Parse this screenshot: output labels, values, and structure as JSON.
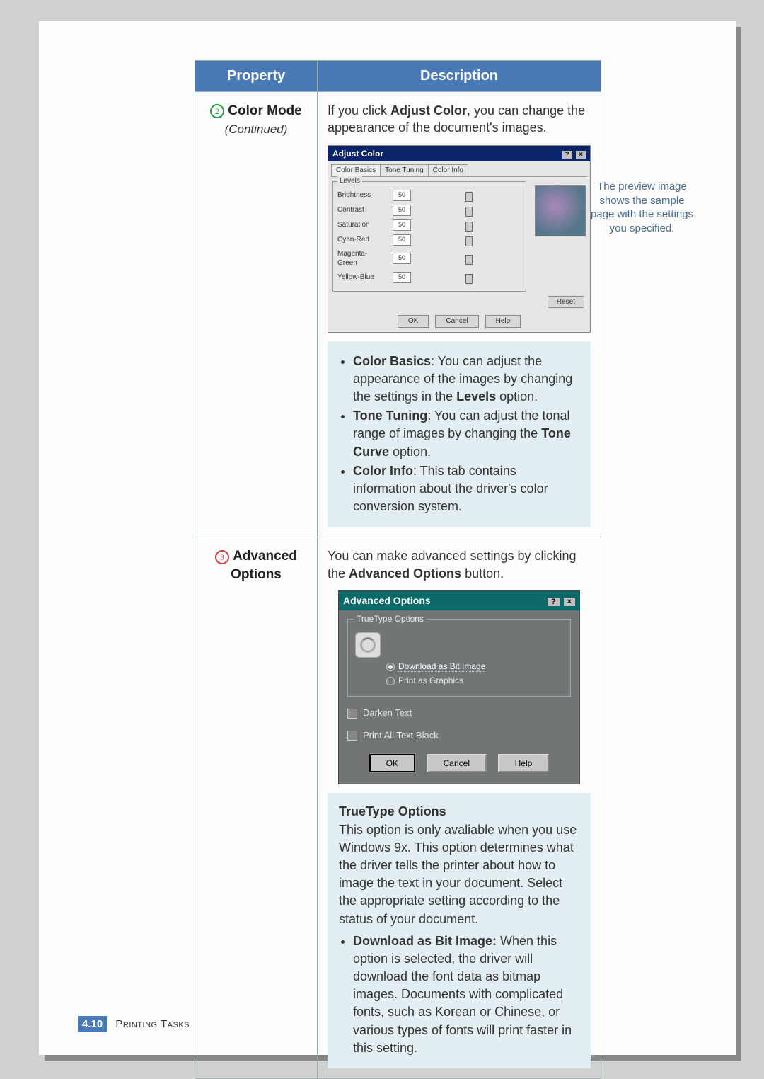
{
  "table": {
    "header_property": "Property",
    "header_description": "Description"
  },
  "row1": {
    "badge_num": "2",
    "title": "Color Mode",
    "subtitle": "(Continued)",
    "intro_a": "If you click ",
    "intro_b": "Adjust Color",
    "intro_c": ", you can change the appearance of the document's images.",
    "dialog": {
      "title": "Adjust Color",
      "tab1": "Color Basics",
      "tab2": "Tone Tuning",
      "tab3": "Color Info",
      "levels_label": "Levels",
      "sliders": [
        {
          "label": "Brightness",
          "value": "50"
        },
        {
          "label": "Contrast",
          "value": "50"
        },
        {
          "label": "Saturation",
          "value": "50"
        },
        {
          "label": "Cyan-Red",
          "value": "50"
        },
        {
          "label": "Magenta-Green",
          "value": "50"
        },
        {
          "label": "Yellow-Blue",
          "value": "50"
        }
      ],
      "reset": "Reset",
      "ok": "OK",
      "cancel": "Cancel",
      "help": "Help"
    },
    "preview_note": "The preview image shows the sample page with the settings you specified.",
    "bullets": {
      "b1a": "Color Basics",
      "b1b": ": You can adjust the appearance of the images by changing the settings in the ",
      "b1c": "Levels",
      "b1d": " option.",
      "b2a": "Tone Tuning",
      "b2b": ": You can adjust the tonal range of images by changing the ",
      "b2c": "Tone Curve",
      "b2d": " option.",
      "b3a": "Color Info",
      "b3b": ": This tab contains information about the driver's color conversion system."
    }
  },
  "row2": {
    "badge_num": "3",
    "title": "Advanced Options",
    "intro_a": "You can make advanced settings by clicking the ",
    "intro_b": "Advanced Options",
    "intro_c": " button.",
    "dialog": {
      "title": "Advanced Options",
      "group": "TrueType Options",
      "opt1": "Download as Bit Image",
      "opt2": "Print as Graphics",
      "chk1": "Darken Text",
      "chk2": "Print All Text Black",
      "ok": "OK",
      "cancel": "Cancel",
      "help": "Help"
    },
    "box": {
      "h": "TrueType Options",
      "p": "This option is only avaliable when you use Windows 9x. This option determines what the driver tells the printer about how to image the text in your document. Select the appropriate setting according to the status of your document.",
      "d1a": "Download as Bit Image:",
      "d1b": " When this option is selected, the driver will download the font data as bitmap images. Documents with complicated fonts, such as Korean or Chinese, or various types of fonts will print faster in this setting."
    }
  },
  "footer": {
    "chapter": "4.",
    "page": "10",
    "section": "Printing Tasks"
  }
}
